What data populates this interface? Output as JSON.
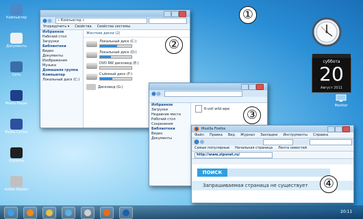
{
  "desktop_icons": [
    {
      "label": "Компьютер",
      "icon": "computer-icon",
      "color": "#4d88c8"
    },
    {
      "label": "Документы",
      "icon": "documents-icon",
      "color": "#f0f0f0"
    },
    {
      "label": "Сеть",
      "icon": "network-icon",
      "color": "#3b6ea8"
    },
    {
      "label": "Media Player",
      "icon": "media-player-icon",
      "color": "#1f3f8a"
    },
    {
      "label": "Media Center",
      "icon": "media-center-icon",
      "color": "#2f4f9f"
    },
    {
      "label": "Корзина",
      "icon": "recycle-bin-icon",
      "color": "#202020"
    },
    {
      "label": "Adobe Reader",
      "icon": "adobe-reader-icon",
      "color": "#c0c0c0"
    }
  ],
  "markers": [
    "①",
    "②",
    "③",
    "④"
  ],
  "gadgets": {
    "calendar": {
      "weekday": "суббота",
      "day": "20",
      "month_year": "Август 2011"
    },
    "tray_label": "Monitor"
  },
  "explorer_window": {
    "address": "« Компьютер »",
    "toolbar": [
      "Упорядочить ▾",
      "Свойства",
      "Свойства системы"
    ],
    "nav": [
      {
        "label": "Избранное",
        "header": true
      },
      {
        "label": "Рабочий стол"
      },
      {
        "label": "Загрузки"
      },
      {
        "label": "Библиотеки",
        "header": true
      },
      {
        "label": "Видео"
      },
      {
        "label": "Документы"
      },
      {
        "label": "Изображения"
      },
      {
        "label": "Музыка"
      },
      {
        "label": "Домашняя группа",
        "header": true
      },
      {
        "label": "Компьютер",
        "header": true
      },
      {
        "label": "Локальный диск (C:)"
      }
    ],
    "section_title": "Жесткие диски (2)",
    "drives": [
      {
        "name": "Локальный диск (C:)",
        "fill": 0.55
      },
      {
        "name": "Локальный диск (D:)",
        "fill": 0.35
      },
      {
        "name": "DVD RW дисковод (E:)",
        "fill": 0.0
      },
      {
        "name": "Съёмный диск (F:)",
        "fill": 0.4
      }
    ],
    "device_item": "Дисковод (G:)"
  },
  "folder_window": {
    "nav": [
      {
        "label": "Избранное",
        "header": true
      },
      {
        "label": "Загрузки"
      },
      {
        "label": "Недавние места"
      },
      {
        "label": "Рабочий стол"
      },
      {
        "label": "Сохранения"
      },
      {
        "label": "Библиотеки",
        "header": true
      },
      {
        "label": "Видео"
      },
      {
        "label": "Документы"
      }
    ],
    "file_item": "6-voll wild.wpe"
  },
  "browser_window": {
    "title": "Mozilla Firefox",
    "menu": [
      "Файл",
      "Правка",
      "Вид",
      "Журнал",
      "Закладки",
      "Инструменты",
      "Справка"
    ],
    "bookmarks": [
      "Самые популярные",
      "Начальная страница",
      "Лента новостей"
    ],
    "url": "http://www.zipsnet.ru/",
    "search_button": "ПОИСК",
    "error_text": "Запрашиваемая страница не существует"
  },
  "taskbar": {
    "items": [
      {
        "icon": "start-icon",
        "color": "#3aa0e8"
      },
      {
        "icon": "media-player-icon",
        "color": "#f08a1c"
      },
      {
        "icon": "explorer-icon",
        "color": "#e7c04a"
      },
      {
        "icon": "libraries-icon",
        "color": "#5ab0e8"
      },
      {
        "icon": "mail-icon",
        "color": "#d0d0d0"
      },
      {
        "icon": "firefox-icon",
        "color": "#e86a1c"
      },
      {
        "icon": "firefox-icon",
        "color": "#1a5fb0"
      }
    ],
    "clock": "20:11"
  }
}
